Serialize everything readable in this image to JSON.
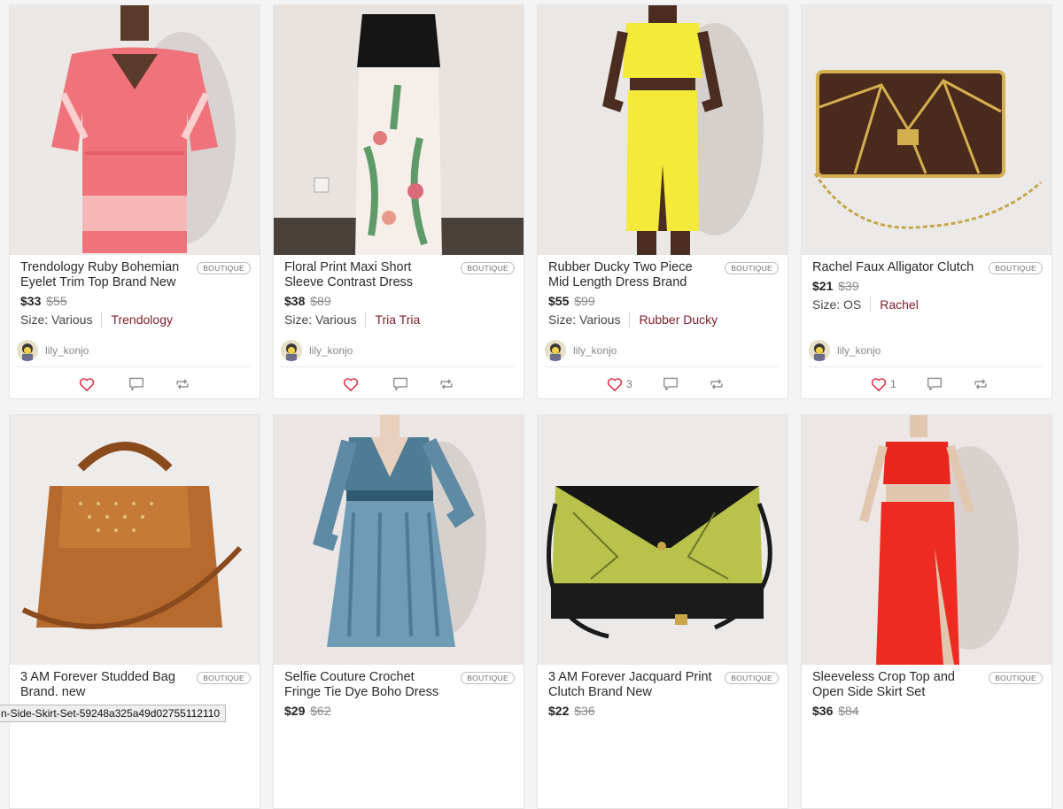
{
  "badge_label": "BOUTIQUE",
  "colors": {
    "brand_link": "#7c1d2e",
    "like_heart": "#d4263c"
  },
  "listings": [
    {
      "title": "Trendology Ruby Bohemian Eyelet Trim Top Brand New",
      "price": "$33",
      "original_price": "$55",
      "size": "Size: Various",
      "brand": "Trendology",
      "seller": "lily_konjo",
      "likes": ""
    },
    {
      "title": "Floral Print Maxi Short Sleeve Contrast Dress",
      "price": "$38",
      "original_price": "$89",
      "size": "Size: Various",
      "brand": "Tria Tria",
      "seller": "lily_konjo",
      "likes": ""
    },
    {
      "title": "Rubber Ducky Two Piece Mid Length Dress Brand New",
      "price": "$55",
      "original_price": "$99",
      "size": "Size: Various",
      "brand": "Rubber Ducky",
      "seller": "lily_konjo",
      "likes": "3"
    },
    {
      "title": "Rachel Faux Alligator Clutch",
      "price": "$21",
      "original_price": "$39",
      "size": "Size: OS",
      "brand": "Rachel",
      "seller": "lily_konjo",
      "likes": "1"
    },
    {
      "title": "3 AM Forever Studded Bag Brand. new",
      "price": "",
      "original_price": "",
      "size": "",
      "brand": "",
      "seller": "",
      "likes": ""
    },
    {
      "title": "Selfie Couture Crochet Fringe Tie Dye Boho Dress",
      "price": "$29",
      "original_price": "$62",
      "size": "",
      "brand": "",
      "seller": "",
      "likes": ""
    },
    {
      "title": "3 AM Forever Jacquard Print Clutch Brand New",
      "price": "$22",
      "original_price": "$36",
      "size": "",
      "brand": "",
      "seller": "",
      "likes": ""
    },
    {
      "title": "Sleeveless Crop Top and Open Side Skirt Set",
      "price": "$36",
      "original_price": "$84",
      "size": "",
      "brand": "",
      "seller": "",
      "likes": ""
    }
  ],
  "status_bar": {
    "hover_url": "n-Side-Skirt-Set-59248a325a49d02755112110"
  }
}
